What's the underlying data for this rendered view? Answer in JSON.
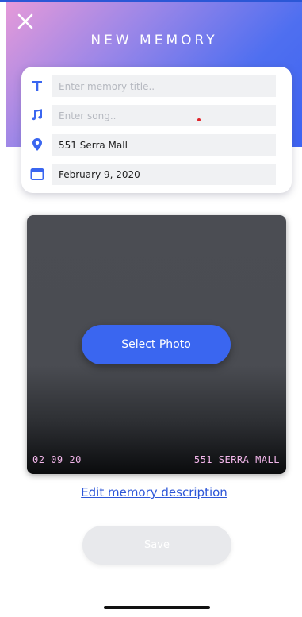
{
  "header": {
    "title": "NEW MEMORY",
    "close_icon": "close-icon"
  },
  "form": {
    "title_field": {
      "icon": "text-icon",
      "value": "",
      "placeholder": "Enter memory title.."
    },
    "song_field": {
      "icon": "music-note-icon",
      "value": "",
      "placeholder": "Enter song.."
    },
    "location_field": {
      "icon": "location-pin-icon",
      "value": "551 Serra Mall",
      "placeholder": ""
    },
    "date_field": {
      "icon": "calendar-icon",
      "value": "February 9, 2020",
      "placeholder": ""
    }
  },
  "photo": {
    "select_label": "Select Photo",
    "stamp_date": "02 09 20",
    "stamp_location": "551 SERRA MALL"
  },
  "actions": {
    "edit_description_label": "Edit memory description",
    "save_label": "Save"
  },
  "colors": {
    "accent": "#3a66f0",
    "link": "#2e57d8",
    "stamp": "#f2b6ea",
    "header_gradient_start": "#e59ad9",
    "header_gradient_end": "#3d63f2",
    "disabled_button": "#e8e9ec"
  }
}
